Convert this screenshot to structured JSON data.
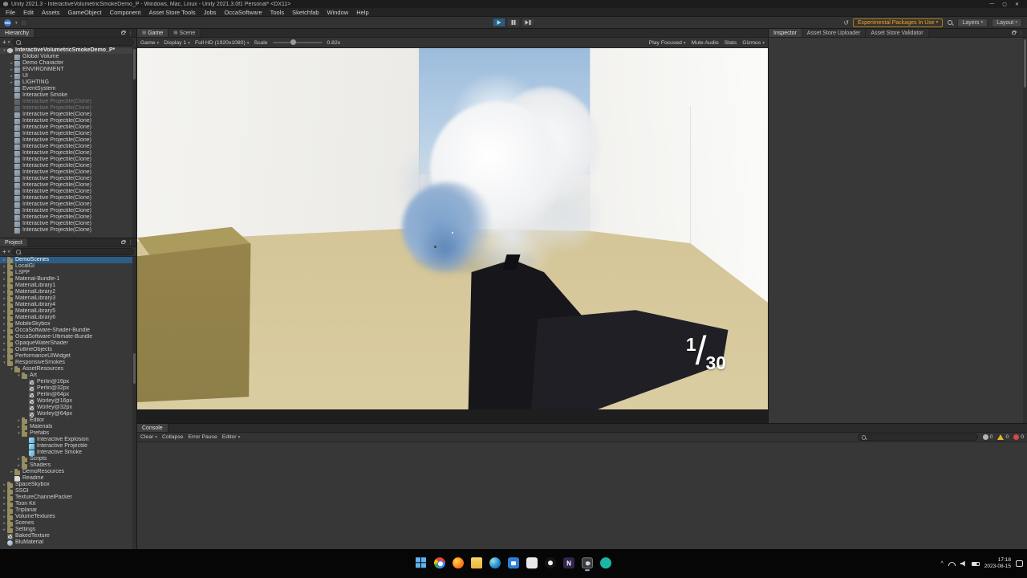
{
  "colors": {
    "selection": "#2d5c87",
    "experimental_warning": "#e8a33b",
    "play_active": "#2f5a7a",
    "taskbar_accent": "#8fb6d8"
  },
  "window": {
    "title": "Unity 2021.3 - InteractiveVolumetricSmokeDemo_P - Windows, Mac, Linux - Unity 2021.3.0f1 Personal* <DX11>",
    "menus": [
      "File",
      "Edit",
      "Assets",
      "GameObject",
      "Component",
      "Asset Store Tools",
      "Jobs",
      "OccaSoftware",
      "Tools",
      "Sketchfab",
      "Window",
      "Help"
    ],
    "controls": {
      "minimize": "—",
      "maximize": "▢",
      "close": "✕"
    }
  },
  "toolbar": {
    "account_label": "MS",
    "experimental_badge": "Experimental Packages In Use",
    "layers_label": "Layers",
    "layout_label": "Layout"
  },
  "hierarchy": {
    "tab": "Hierarchy",
    "add_button": "+",
    "items": [
      {
        "label": "InteractiveVolumetricSmokeDemo_P*",
        "d": 0,
        "a": "▾",
        "t": "scene",
        "scene": true
      },
      {
        "label": "Global Volume",
        "d": 1,
        "t": "go"
      },
      {
        "label": "Demo Character",
        "d": 1,
        "a": "▸",
        "t": "go"
      },
      {
        "label": "ENVIRONMENT",
        "d": 1,
        "a": "▸",
        "t": "go"
      },
      {
        "label": "UI",
        "d": 1,
        "a": "▸",
        "t": "go"
      },
      {
        "label": "LIGHTING",
        "d": 1,
        "a": "▸",
        "t": "go"
      },
      {
        "label": "EventSystem",
        "d": 1,
        "t": "go"
      },
      {
        "label": "Interactive Smoke",
        "d": 1,
        "t": "go"
      },
      {
        "label": "Interactive Projectile(Clone)",
        "d": 1,
        "t": "go",
        "dim": true
      },
      {
        "label": "Interactive Projectile(Clone)",
        "d": 1,
        "t": "go",
        "dim": true
      },
      {
        "label": "Interactive Projectile(Clone)",
        "d": 1,
        "t": "go"
      },
      {
        "label": "Interactive Projectile(Clone)",
        "d": 1,
        "t": "go"
      },
      {
        "label": "Interactive Projectile(Clone)",
        "d": 1,
        "t": "go"
      },
      {
        "label": "Interactive Projectile(Clone)",
        "d": 1,
        "t": "go"
      },
      {
        "label": "Interactive Projectile(Clone)",
        "d": 1,
        "t": "go"
      },
      {
        "label": "Interactive Projectile(Clone)",
        "d": 1,
        "t": "go"
      },
      {
        "label": "Interactive Projectile(Clone)",
        "d": 1,
        "t": "go"
      },
      {
        "label": "Interactive Projectile(Clone)",
        "d": 1,
        "t": "go"
      },
      {
        "label": "Interactive Projectile(Clone)",
        "d": 1,
        "t": "go"
      },
      {
        "label": "Interactive Projectile(Clone)",
        "d": 1,
        "t": "go"
      },
      {
        "label": "Interactive Projectile(Clone)",
        "d": 1,
        "t": "go"
      },
      {
        "label": "Interactive Projectile(Clone)",
        "d": 1,
        "t": "go"
      },
      {
        "label": "Interactive Projectile(Clone)",
        "d": 1,
        "t": "go"
      },
      {
        "label": "Interactive Projectile(Clone)",
        "d": 1,
        "t": "go"
      },
      {
        "label": "Interactive Projectile(Clone)",
        "d": 1,
        "t": "go"
      },
      {
        "label": "Interactive Projectile(Clone)",
        "d": 1,
        "t": "go"
      },
      {
        "label": "Interactive Projectile(Clone)",
        "d": 1,
        "t": "go"
      },
      {
        "label": "Interactive Projectile(Clone)",
        "d": 1,
        "t": "go"
      },
      {
        "label": "Interactive Projectile(Clone)",
        "d": 1,
        "t": "go"
      }
    ]
  },
  "project": {
    "tab": "Project",
    "add_button": "+",
    "items": [
      {
        "label": "DemoScenes",
        "d": 0,
        "a": "▸",
        "t": "folder",
        "sel": true
      },
      {
        "label": "LocalGI",
        "d": 0,
        "a": "▸",
        "t": "folder"
      },
      {
        "label": "LSPP",
        "d": 0,
        "a": "▸",
        "t": "folder"
      },
      {
        "label": "Material-Bundle-1",
        "d": 0,
        "a": "▸",
        "t": "folder"
      },
      {
        "label": "MaterialLibrary1",
        "d": 0,
        "a": "▸",
        "t": "folder"
      },
      {
        "label": "MaterialLibrary2",
        "d": 0,
        "a": "▸",
        "t": "folder"
      },
      {
        "label": "MaterialLibrary3",
        "d": 0,
        "a": "▸",
        "t": "folder"
      },
      {
        "label": "MaterialLibrary4",
        "d": 0,
        "a": "▸",
        "t": "folder"
      },
      {
        "label": "MaterialLibrary5",
        "d": 0,
        "a": "▸",
        "t": "folder"
      },
      {
        "label": "MaterialLibrary6",
        "d": 0,
        "a": "▸",
        "t": "folder"
      },
      {
        "label": "MobileSkybox",
        "d": 0,
        "a": "▸",
        "t": "folder"
      },
      {
        "label": "OccaSoftware-Shader-Bundle",
        "d": 0,
        "a": "▸",
        "t": "folder"
      },
      {
        "label": "OccaSoftware-Ultimate-Bundle",
        "d": 0,
        "a": "▸",
        "t": "folder"
      },
      {
        "label": "OpaqueWaterShader",
        "d": 0,
        "a": "▸",
        "t": "folder"
      },
      {
        "label": "OutlineObjects",
        "d": 0,
        "a": "▸",
        "t": "folder"
      },
      {
        "label": "PerformanceUIWidget",
        "d": 0,
        "a": "▸",
        "t": "folder"
      },
      {
        "label": "ResponsiveSmokes",
        "d": 0,
        "a": "▾",
        "t": "folder"
      },
      {
        "label": "AssetResources",
        "d": 1,
        "a": "▾",
        "t": "folder"
      },
      {
        "label": "Art",
        "d": 2,
        "a": "▾",
        "t": "folder"
      },
      {
        "label": "Perlin@16px",
        "d": 3,
        "t": "tex"
      },
      {
        "label": "Perlin@32px",
        "d": 3,
        "t": "tex"
      },
      {
        "label": "Perlin@64px",
        "d": 3,
        "t": "tex"
      },
      {
        "label": "Worley@16px",
        "d": 3,
        "t": "tex"
      },
      {
        "label": "Worley@32px",
        "d": 3,
        "t": "tex"
      },
      {
        "label": "Worley@64px",
        "d": 3,
        "t": "tex"
      },
      {
        "label": "Editor",
        "d": 2,
        "a": "▸",
        "t": "folder"
      },
      {
        "label": "Materials",
        "d": 2,
        "a": "▸",
        "t": "folder"
      },
      {
        "label": "Prefabs",
        "d": 2,
        "a": "▾",
        "t": "folder"
      },
      {
        "label": "Interactive Explosion",
        "d": 3,
        "t": "prefab"
      },
      {
        "label": "Interactive Projectile",
        "d": 3,
        "t": "prefab"
      },
      {
        "label": "Interactive Smoke",
        "d": 3,
        "t": "prefab"
      },
      {
        "label": "Scripts",
        "d": 2,
        "a": "▸",
        "t": "folder"
      },
      {
        "label": "Shaders",
        "d": 2,
        "a": "▸",
        "t": "folder"
      },
      {
        "label": "DemoResources",
        "d": 1,
        "a": "▸",
        "t": "folder"
      },
      {
        "label": "Readme",
        "d": 1,
        "t": "doc"
      },
      {
        "label": "SpaceSkybox",
        "d": 0,
        "a": "▸",
        "t": "folder"
      },
      {
        "label": "SSGI",
        "d": 0,
        "a": "▸",
        "t": "folder"
      },
      {
        "label": "TextureChannelPacker",
        "d": 0,
        "a": "▸",
        "t": "folder"
      },
      {
        "label": "Toon Kit",
        "d": 0,
        "a": "▸",
        "t": "folder"
      },
      {
        "label": "Triplanar",
        "d": 0,
        "a": "▸",
        "t": "folder"
      },
      {
        "label": "VolumeTextures",
        "d": 0,
        "a": "▸",
        "t": "folder"
      },
      {
        "label": "Scenes",
        "d": 0,
        "a": "▸",
        "t": "folder"
      },
      {
        "label": "Settings",
        "d": 0,
        "a": "▸",
        "t": "folder"
      },
      {
        "label": "BakedTexture",
        "d": 0,
        "t": "tex"
      },
      {
        "label": "BluMaterial",
        "d": 0,
        "t": "mat"
      }
    ]
  },
  "game": {
    "tabs": [
      "Game",
      "Scene"
    ],
    "toolbar": {
      "mode": "Game",
      "display": "Display 1",
      "resolution": "Full HD (1920x1080)",
      "scale_label": "Scale",
      "scale_value": "0.82x",
      "play_focused": "Play Focused",
      "mute_audio": "Mute Audio",
      "stats": "Stats",
      "gizmos": "Gizmos"
    },
    "hud": {
      "ammo_current": "1",
      "ammo_divider": "/",
      "ammo_max": "30"
    }
  },
  "console": {
    "tab": "Console",
    "clear": "Clear",
    "collapse": "Collapse",
    "error_pause": "Error Pause",
    "editor": "Editor",
    "counters": [
      {
        "type": "info",
        "count": "0"
      },
      {
        "type": "warning",
        "count": "0"
      },
      {
        "type": "error",
        "count": "0"
      }
    ]
  },
  "inspector": {
    "tabs": [
      "Inspector",
      "Asset Store Uploader",
      "Asset Store Validator"
    ]
  },
  "taskbar": {
    "time": "17:18",
    "date": "2023-08-15",
    "icons": [
      {
        "name": "start",
        "cls": "start"
      },
      {
        "name": "chrome",
        "cls": "chrome"
      },
      {
        "name": "firefox",
        "cls": "firefox"
      },
      {
        "name": "file-explorer",
        "cls": "explorer"
      },
      {
        "name": "edge",
        "cls": "edge"
      },
      {
        "name": "microsoft-store",
        "cls": "store"
      },
      {
        "name": "light-app",
        "cls": "white"
      },
      {
        "name": "github",
        "cls": "github"
      },
      {
        "name": "notion",
        "cls": "notion",
        "glyph": "N"
      },
      {
        "name": "unity-editor",
        "cls": "unity",
        "active": true
      },
      {
        "name": "unity-hub",
        "cls": "hub"
      }
    ]
  }
}
